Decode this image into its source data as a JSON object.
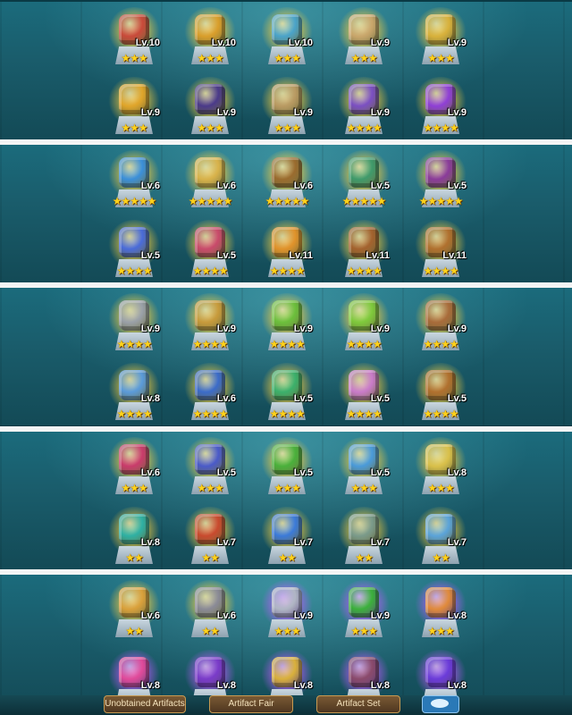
{
  "strips": [
    {
      "rows": [
        [
          {
            "name": "red-tome-icon",
            "lv": "Lv.10",
            "stars": "★★★",
            "color": "#c94a3a"
          },
          {
            "name": "golden-eye-icon",
            "lv": "Lv.10",
            "stars": "★★★",
            "color": "#d99e2b"
          },
          {
            "name": "crystal-bowl-icon",
            "lv": "Lv.10",
            "stars": "★★★",
            "color": "#4aa3c9"
          },
          {
            "name": "ancient-map-icon",
            "lv": "Lv.9",
            "stars": "★★★",
            "color": "#c9a66b"
          },
          {
            "name": "golden-staff-icon",
            "lv": "Lv.9",
            "stars": "★★★",
            "color": "#d8b13b"
          }
        ],
        [
          {
            "name": "golden-wings-icon",
            "lv": "Lv.9",
            "stars": "★★★",
            "color": "#e0a52a"
          },
          {
            "name": "dark-hat-icon",
            "lv": "Lv.9",
            "stars": "★★★",
            "color": "#4b3a8a"
          },
          {
            "name": "feather-quill-icon",
            "lv": "Lv.9",
            "stars": "★★★",
            "color": "#b99a62"
          },
          {
            "name": "purple-imp-icon",
            "lv": "Lv.9",
            "stars": "★★★★",
            "color": "#7b4fc2"
          },
          {
            "name": "purple-orb-icon",
            "lv": "Lv.9",
            "stars": "★★★★",
            "color": "#8f3fd6"
          }
        ]
      ]
    },
    {
      "rows": [
        [
          {
            "name": "blue-compass-icon",
            "lv": "Lv.6",
            "stars": "★★★★★",
            "color": "#3b8fd9"
          },
          {
            "name": "hourglass-icon",
            "lv": "Lv.6",
            "stars": "★★★★★",
            "color": "#d8b24a"
          },
          {
            "name": "bow-icon",
            "lv": "Lv.6",
            "stars": "★★★★★",
            "color": "#9a6b2e"
          },
          {
            "name": "flower-book-icon",
            "lv": "Lv.5",
            "stars": "★★★★★",
            "color": "#3f9a6b"
          },
          {
            "name": "purple-helm-icon",
            "lv": "Lv.5",
            "stars": "★★★★★",
            "color": "#8a3b9a"
          }
        ],
        [
          {
            "name": "blue-potion-icon",
            "lv": "Lv.5",
            "stars": "★★★★",
            "color": "#4a6bd9"
          },
          {
            "name": "red-flower-icon",
            "lv": "Lv.5",
            "stars": "★★★★",
            "color": "#c94a6b"
          },
          {
            "name": "honey-jar-icon",
            "lv": "Lv.11",
            "stars": "★★★★",
            "color": "#e0922a"
          },
          {
            "name": "wooden-chest-icon",
            "lv": "Lv.11",
            "stars": "★★★★",
            "color": "#a3622e"
          },
          {
            "name": "brown-book-icon",
            "lv": "Lv.11",
            "stars": "★★★★",
            "color": "#b0702e"
          }
        ]
      ]
    },
    {
      "rows": [
        [
          {
            "name": "war-hammer-icon",
            "lv": "Lv.9",
            "stars": "★★★★",
            "color": "#9aa0a8"
          },
          {
            "name": "golden-statue-icon",
            "lv": "Lv.9",
            "stars": "★★★★",
            "color": "#c79a3b"
          },
          {
            "name": "green-lamp-icon",
            "lv": "Lv.9",
            "stars": "★★★★",
            "color": "#6bbf3b"
          },
          {
            "name": "green-vial-icon",
            "lv": "Lv.9",
            "stars": "★★★★",
            "color": "#7ec93b"
          },
          {
            "name": "leather-pouch-icon",
            "lv": "Lv.9",
            "stars": "★★★★",
            "color": "#a86b3a"
          }
        ],
        [
          {
            "name": "blue-teapot-icon",
            "lv": "Lv.8",
            "stars": "★★★★",
            "color": "#5a9ad9"
          },
          {
            "name": "blue-vase-icon",
            "lv": "Lv.6",
            "stars": "★★★★",
            "color": "#3b6bc9"
          },
          {
            "name": "green-dragon-icon",
            "lv": "Lv.5",
            "stars": "★★★★",
            "color": "#3bb06b"
          },
          {
            "name": "pink-feather-icon",
            "lv": "Lv.5",
            "stars": "★★★★",
            "color": "#c97bc9"
          },
          {
            "name": "wooden-door-icon",
            "lv": "Lv.5",
            "stars": "★★★★",
            "color": "#b0702e"
          }
        ]
      ]
    },
    {
      "rows": [
        [
          {
            "name": "pink-bow-icon",
            "lv": "Lv.6",
            "stars": "★★★",
            "color": "#c93b6b"
          },
          {
            "name": "royal-cloak-icon",
            "lv": "Lv.5",
            "stars": "★★★",
            "color": "#4a5ac9"
          },
          {
            "name": "green-shell-icon",
            "lv": "Lv.5",
            "stars": "★★★",
            "color": "#4ab03b"
          },
          {
            "name": "blue-flower-icon",
            "lv": "Lv.5",
            "stars": "★★★",
            "color": "#4a9ad9"
          },
          {
            "name": "pendulum-icon",
            "lv": "Lv.8",
            "stars": "★★★",
            "color": "#d9c04a"
          }
        ],
        [
          {
            "name": "teal-urn-icon",
            "lv": "Lv.8",
            "stars": "★★",
            "color": "#2eb0a3"
          },
          {
            "name": "red-lantern-icon",
            "lv": "Lv.7",
            "stars": "★★",
            "color": "#c94a2e"
          },
          {
            "name": "blue-box-icon",
            "lv": "Lv.7",
            "stars": "★★",
            "color": "#3b7ad9"
          },
          {
            "name": "stone-gargoyle-icon",
            "lv": "Lv.7",
            "stars": "★★",
            "color": "#7a9a8a"
          },
          {
            "name": "blue-blossom-icon",
            "lv": "Lv.7",
            "stars": "★★",
            "color": "#5aa3d9"
          }
        ]
      ]
    },
    {
      "rows": [
        [
          {
            "name": "golden-shield-icon",
            "lv": "Lv.6",
            "stars": "★★",
            "color": "#d9a03b"
          },
          {
            "name": "iron-helm-icon",
            "lv": "Lv.6",
            "stars": "★★",
            "color": "#8a8a96"
          },
          {
            "name": "silver-armor-icon",
            "lv": "Lv.9",
            "stars": "★★★",
            "color": "#b0b6c4",
            "purple": true
          },
          {
            "name": "green-orb-icon",
            "lv": "Lv.9",
            "stars": "★★★",
            "color": "#3bb03b",
            "purple": true
          },
          {
            "name": "orange-flask-icon",
            "lv": "Lv.8",
            "stars": "★★★",
            "color": "#e08a3b",
            "purple": true
          }
        ],
        [
          {
            "name": "pink-potion-icon",
            "lv": "Lv.8",
            "stars": "★★★",
            "color": "#e04a9a",
            "purple": true
          },
          {
            "name": "dark-crown-icon",
            "lv": "Lv.8",
            "stars": "★★★",
            "color": "#7a3bc9",
            "purple": true
          },
          {
            "name": "golden-harp-icon",
            "lv": "Lv.8",
            "stars": "★★★",
            "color": "#d9b03b",
            "purple": true
          },
          {
            "name": "dark-flute-icon",
            "lv": "Lv.8",
            "stars": "★★★",
            "color": "#8a4a6b",
            "purple": true
          },
          {
            "name": "purple-crescent-icon",
            "lv": "Lv.8",
            "stars": "★★★",
            "color": "#6b3bd9",
            "purple": true
          }
        ]
      ]
    }
  ],
  "bottom_bar": {
    "unobtained": "Unobtained Artifacts",
    "fair": "Artifact Fair",
    "set": "Artifact Set"
  }
}
